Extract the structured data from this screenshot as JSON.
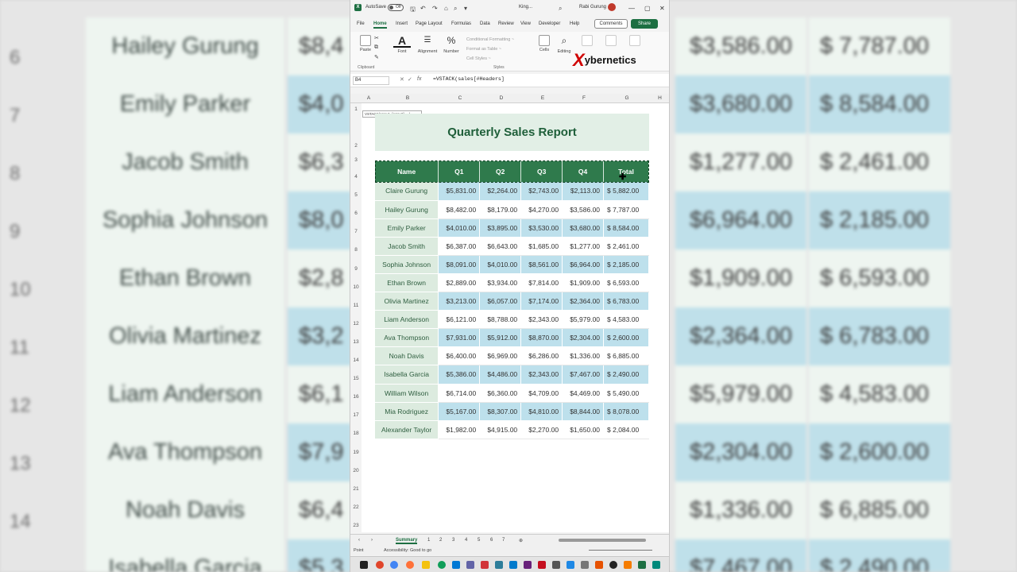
{
  "window": {
    "autosave_label": "AutoSave",
    "autosave_state": "Off",
    "file_name": "King...",
    "user_name": "Rabi Gurung"
  },
  "menu_tabs": [
    "File",
    "Home",
    "Insert",
    "Page Layout",
    "Formulas",
    "Data",
    "Review",
    "View",
    "Developer",
    "Help"
  ],
  "active_tab": "Home",
  "comments_label": "Comments",
  "share_label": "Share",
  "ribbon": {
    "paste": "Paste",
    "clipboard": "Clipboard",
    "font": "Font",
    "alignment": "Alignment",
    "number": "Number",
    "conditional_formatting": "Conditional Formatting ~",
    "format_as_table": "Format as Table ~",
    "cell_styles": "Cell Styles ~",
    "styles": "Styles",
    "cells": "Cells",
    "editing": "Editing",
    "brand_x": "X",
    "brand_rest": "ybernetics"
  },
  "formula_bar": {
    "name_box": "B4",
    "formula": "=VSTACK(sales[#Headers]"
  },
  "tooltip": "VSTACK(array1, [array2], ...)",
  "columns": [
    "A",
    "B",
    "C",
    "D",
    "E",
    "F",
    "G",
    "H"
  ],
  "row_numbers": [
    "1",
    "2",
    "3",
    "4",
    "5",
    "6",
    "7",
    "8",
    "9",
    "10",
    "11",
    "12",
    "13",
    "14",
    "15",
    "16",
    "17",
    "18",
    "19",
    "20",
    "21",
    "22",
    "23"
  ],
  "report_title": "Quarterly Sales Report",
  "table_headers": [
    "Name",
    "Q1",
    "Q2",
    "Q3",
    "Q4",
    "Total"
  ],
  "rows": [
    [
      "Claire Gurung",
      "$5,831.00",
      "$2,264.00",
      "$2,743.00",
      "$2,113.00",
      "$  5,882.00"
    ],
    [
      "Hailey Gurung",
      "$8,482.00",
      "$8,179.00",
      "$4,270.00",
      "$3,586.00",
      "$  7,787.00"
    ],
    [
      "Emily Parker",
      "$4,010.00",
      "$3,895.00",
      "$3,530.00",
      "$3,680.00",
      "$  8,584.00"
    ],
    [
      "Jacob Smith",
      "$6,387.00",
      "$6,643.00",
      "$1,685.00",
      "$1,277.00",
      "$  2,461.00"
    ],
    [
      "Sophia Johnson",
      "$8,091.00",
      "$4,010.00",
      "$8,561.00",
      "$6,964.00",
      "$  2,185.00"
    ],
    [
      "Ethan Brown",
      "$2,889.00",
      "$3,934.00",
      "$7,814.00",
      "$1,909.00",
      "$  6,593.00"
    ],
    [
      "Olivia Martinez",
      "$3,213.00",
      "$6,057.00",
      "$7,174.00",
      "$2,364.00",
      "$  6,783.00"
    ],
    [
      "Liam Anderson",
      "$6,121.00",
      "$8,788.00",
      "$2,343.00",
      "$5,979.00",
      "$  4,583.00"
    ],
    [
      "Ava Thompson",
      "$7,931.00",
      "$5,912.00",
      "$8,870.00",
      "$2,304.00",
      "$  2,600.00"
    ],
    [
      "Noah Davis",
      "$6,400.00",
      "$6,969.00",
      "$6,286.00",
      "$1,336.00",
      "$  6,885.00"
    ],
    [
      "Isabella Garcia",
      "$5,386.00",
      "$4,486.00",
      "$2,343.00",
      "$7,467.00",
      "$  2,490.00"
    ],
    [
      "William Wilson",
      "$6,714.00",
      "$6,360.00",
      "$4,709.00",
      "$4,469.00",
      "$  5,490.00"
    ],
    [
      "Mia Rodriguez",
      "$5,167.00",
      "$8,307.00",
      "$4,810.00",
      "$8,844.00",
      "$  8,078.00"
    ],
    [
      "Alexander Taylor",
      "$1,982.00",
      "$4,915.00",
      "$2,270.00",
      "$1,650.00",
      "$  2,084.00"
    ]
  ],
  "sheet_tabs": [
    "Summary",
    "1",
    "2",
    "3",
    "4",
    "5",
    "6",
    "7"
  ],
  "status": {
    "mode": "Point",
    "accessibility": "Accessibility: Good to go"
  },
  "background": {
    "row_numbers": [
      "6",
      "7",
      "8",
      "9",
      "10",
      "11",
      "12",
      "13",
      "14"
    ],
    "names": [
      "Hailey Gurung",
      "Emily Parker",
      "Jacob Smith",
      "Sophia Johnson",
      "Ethan Brown",
      "Olivia Martinez",
      "Liam Anderson",
      "Ava Thompson",
      "Noah Davis",
      "Isabella Garcia"
    ],
    "q1_partial": [
      "$8,4",
      "$4,0",
      "$6,3",
      "$8,0",
      "$2,8",
      "$3,2",
      "$6,1",
      "$7,9",
      "$6,4",
      "$5,3"
    ],
    "q4": [
      "$3,586.00",
      "$3,680.00",
      "$1,277.00",
      "$6,964.00",
      "$1,909.00",
      "$2,364.00",
      "$5,979.00",
      "$2,304.00",
      "$1,336.00",
      "$7,467.00"
    ],
    "total": [
      "$  7,787.00",
      "$  8,584.00",
      "$  2,461.00",
      "$  2,185.00",
      "$  6,593.00",
      "$  6,783.00",
      "$  4,583.00",
      "$  2,600.00",
      "$  6,885.00",
      "$  2,490.00"
    ]
  },
  "colors": {
    "excel_green": "#1d6f42",
    "header_green": "#2f7a4c",
    "name_col": "#dcebdf",
    "band_blue": "#bde0ec",
    "title_text": "#1f5f3a"
  }
}
